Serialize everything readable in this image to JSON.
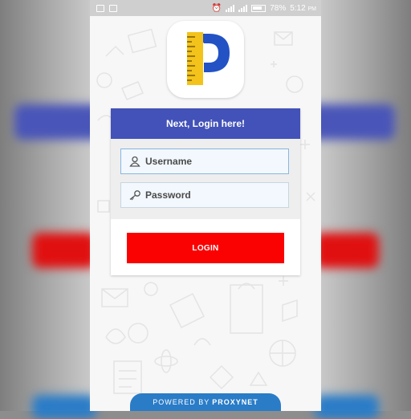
{
  "status_bar": {
    "battery_percent": "78%",
    "time": "5:12",
    "meridiem": "PM"
  },
  "colors": {
    "header_blue": "#4252b8",
    "login_red": "#fb0202",
    "footer_blue": "#2a7cc7",
    "logo_yellow": "#f3c31b",
    "logo_blue": "#2352c4"
  },
  "logo": {
    "icon": "ruler-p-logo"
  },
  "login_card": {
    "header_title": "Next, Login here!",
    "username": {
      "placeholder": "Username",
      "value": "",
      "icon": "user-icon"
    },
    "password": {
      "placeholder": "Password",
      "value": "",
      "icon": "key-icon"
    },
    "login_button_label": "LOGIN"
  },
  "footer": {
    "powered_by": "POWERED BY",
    "brand": "PROXYNET"
  }
}
